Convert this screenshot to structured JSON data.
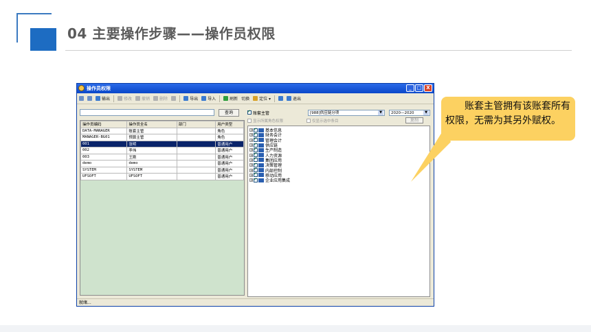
{
  "slide": {
    "title": "04  主要操作步骤——操作员权限"
  },
  "window": {
    "title": "操作员权限",
    "buttons": [
      "_",
      "□",
      "X"
    ],
    "toolbar": [
      {
        "label": "",
        "icon": "print-icon",
        "enabled": true,
        "color": "#6a8fc8"
      },
      {
        "label": "",
        "icon": "preview-icon",
        "enabled": true,
        "color": "#6a8fc8"
      },
      {
        "label": "输出",
        "icon": "output-icon",
        "enabled": true,
        "color": "#3a7ad0"
      },
      {
        "label": "修改",
        "icon": "edit-icon",
        "enabled": false,
        "color": "#b0b0b0"
      },
      {
        "label": "撤销",
        "icon": "undo-icon",
        "enabled": false,
        "color": "#b0b0b0"
      },
      {
        "label": "删除",
        "icon": "delete-icon",
        "enabled": false,
        "color": "#b0b0b0"
      },
      {
        "label": "",
        "icon": "save-icon",
        "enabled": false,
        "color": "#b0b0b0"
      },
      {
        "label": "导出",
        "icon": "export-icon",
        "enabled": true,
        "color": "#3a7ad0"
      },
      {
        "label": "导入",
        "icon": "import-icon",
        "enabled": true,
        "color": "#3a7ad0"
      },
      {
        "label": "刷新",
        "icon": "refresh-icon",
        "enabled": true,
        "color": "#2f9e3e"
      },
      {
        "label": "切换",
        "icon": "",
        "enabled": true,
        "color": ""
      },
      {
        "label": "定位 ▾",
        "icon": "locate-icon",
        "enabled": true,
        "color": "#d8a22a"
      },
      {
        "label": "",
        "icon": "help-icon",
        "enabled": true,
        "color": "#3a7ad0"
      },
      {
        "label": "退出",
        "icon": "exit-icon",
        "enabled": true,
        "color": "#3a7ad0"
      }
    ],
    "search": {
      "value": "",
      "button": "查询"
    },
    "grid": {
      "columns": [
        "操作员编码",
        "操作员全名",
        "部门",
        "用户类型"
      ],
      "rows": [
        [
          "DATA-MANAGER",
          "账套主管",
          "",
          "角色"
        ],
        [
          "MANAGER-BG01",
          "预算主管",
          "",
          "角色"
        ],
        [
          "001",
          "张明",
          "",
          "普通用户"
        ],
        [
          "002",
          "李伟",
          "",
          "普通用户"
        ],
        [
          "003",
          "王刚",
          "",
          "普通用户"
        ],
        [
          "demo",
          "demo",
          "",
          "普通用户"
        ],
        [
          "SYSTEM",
          "SYSTEM",
          "",
          "普通用户"
        ],
        [
          "UFSOFT",
          "UFSOFT",
          "",
          "普通用户"
        ]
      ],
      "selected_row": 2
    },
    "right": {
      "checkbox_label": "账套主管",
      "account_select": "[988]供应链分项",
      "year_select": "2020—2020",
      "opt1": "显示所属角色权限",
      "opt2": "仅显示选中条目",
      "copy_button": "复制",
      "tree": [
        "基本信息",
        "财务会计",
        "管理会计",
        "供应链",
        "生产制造",
        "人力资源",
        "集团应用",
        "决策管理",
        "内部控制",
        "移动应用",
        "企业应用集成"
      ]
    },
    "status": "就绪..."
  },
  "callout": {
    "text": "账套主管拥有该账套所有权限，无需为其另外赋权。",
    "color": "#fcd161"
  }
}
